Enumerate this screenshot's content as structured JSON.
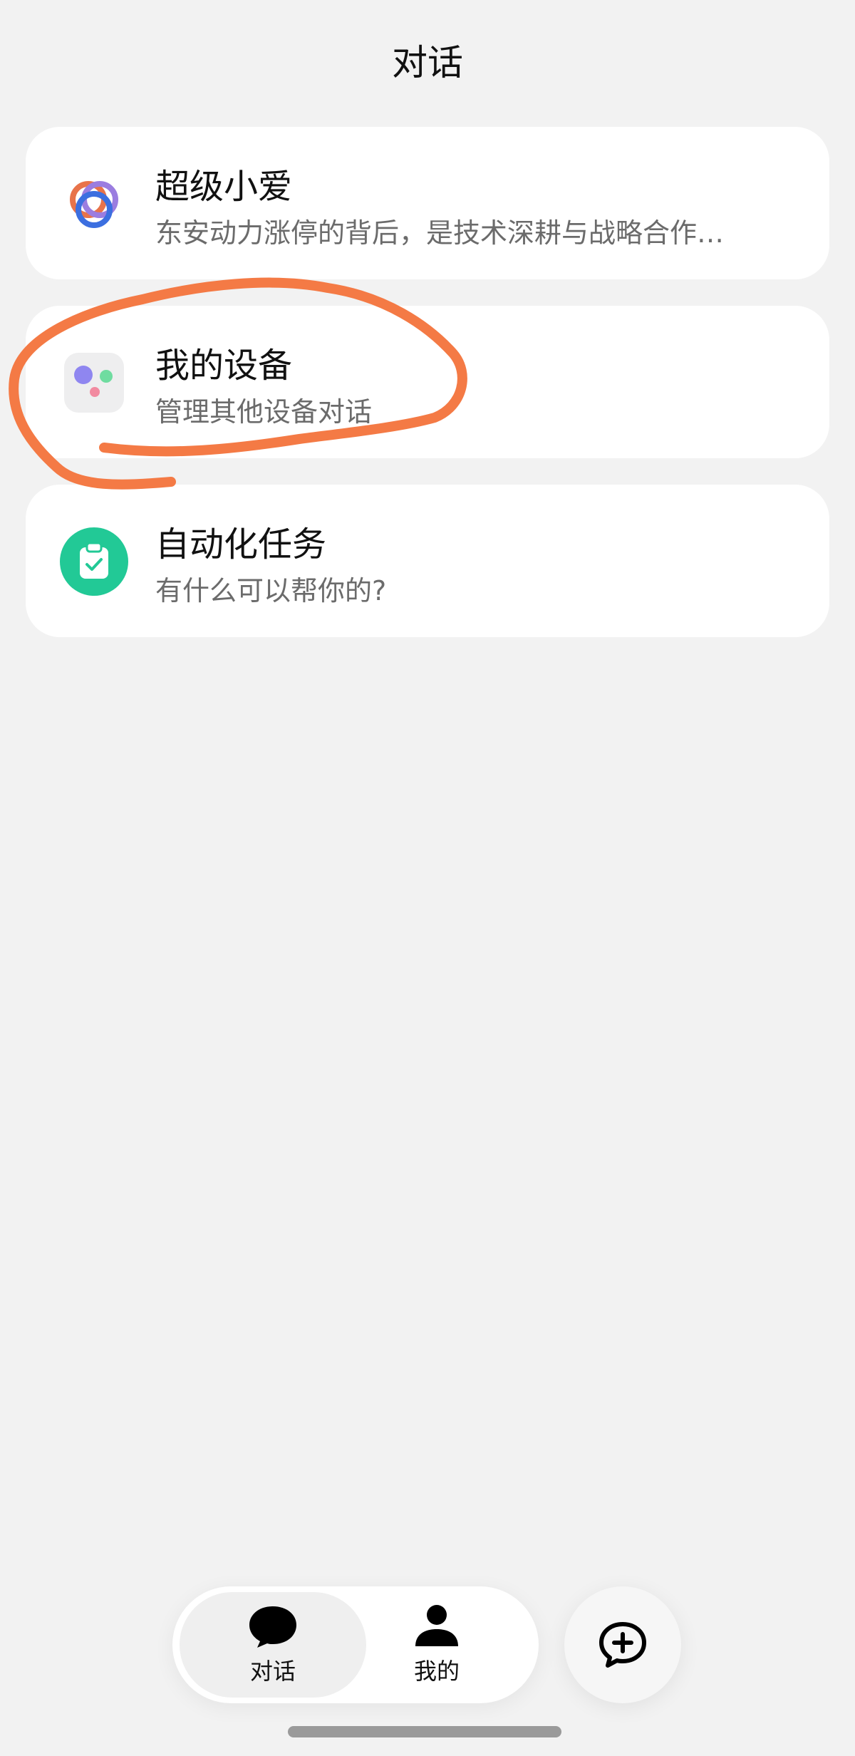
{
  "header": {
    "title": "对话"
  },
  "conversations": [
    {
      "title": "超级小爱",
      "subtitle": "东安动力涨停的背后，是技术深耕与战略合作…"
    },
    {
      "title": "我的设备",
      "subtitle": "管理其他设备对话"
    },
    {
      "title": "自动化任务",
      "subtitle": "有什么可以帮你的?"
    }
  ],
  "tabbar": {
    "tabs": [
      {
        "label": "对话",
        "icon": "chat-bubble-icon",
        "active": true
      },
      {
        "label": "我的",
        "icon": "person-icon",
        "active": false
      }
    ]
  },
  "new_chat_button": {
    "icon": "chat-plus-icon"
  },
  "colors": {
    "background": "#f2f2f2",
    "card": "#ffffff",
    "annotation": "#f47a45",
    "task_green": "#22c996"
  }
}
